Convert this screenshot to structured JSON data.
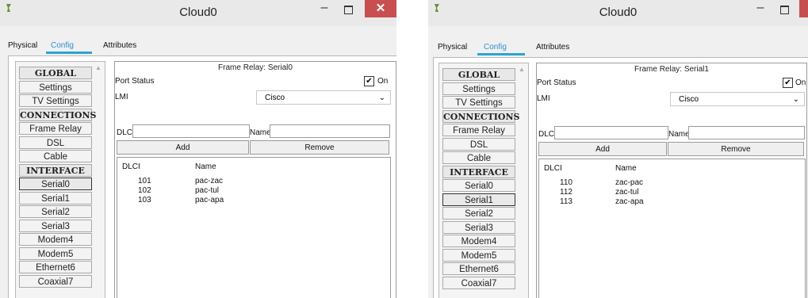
{
  "left": {
    "title": "Cloud0",
    "tabs": [
      "Physical",
      "Config",
      "Attributes"
    ],
    "sidebar": [
      {
        "label": "GLOBAL",
        "type": "header"
      },
      {
        "label": "Settings"
      },
      {
        "label": "TV Settings"
      },
      {
        "label": "CONNECTIONS",
        "type": "header"
      },
      {
        "label": "Frame Relay"
      },
      {
        "label": "DSL"
      },
      {
        "label": "Cable"
      },
      {
        "label": "INTERFACE",
        "type": "header"
      },
      {
        "label": "Serial0",
        "selected": true
      },
      {
        "label": "Serial1"
      },
      {
        "label": "Serial2"
      },
      {
        "label": "Serial3"
      },
      {
        "label": "Modem4"
      },
      {
        "label": "Modem5"
      },
      {
        "label": "Ethernet6"
      },
      {
        "label": "Coaxial7"
      }
    ],
    "frame_title": "Frame Relay: Serial0",
    "port_status_label": "Port Status",
    "on_label": "On",
    "on_checked": "✔",
    "lmi_label": "LMI",
    "lmi_value": "Cisco",
    "dlci_label": "DLCI",
    "name_label": "Name",
    "add_label": "Add",
    "remove_label": "Remove",
    "col_dlci": "DLCI",
    "col_name": "Name",
    "rows": [
      {
        "dlci": "101",
        "name": "pac-zac"
      },
      {
        "dlci": "102",
        "name": "pac-tul"
      },
      {
        "dlci": "103",
        "name": "pac-apa"
      }
    ]
  },
  "right": {
    "title": "Cloud0",
    "tabs": [
      "Physical",
      "Config",
      "Attributes"
    ],
    "sidebar": [
      {
        "label": "GLOBAL",
        "type": "header"
      },
      {
        "label": "Settings"
      },
      {
        "label": "TV Settings"
      },
      {
        "label": "CONNECTIONS",
        "type": "header"
      },
      {
        "label": "Frame Relay"
      },
      {
        "label": "DSL"
      },
      {
        "label": "Cable"
      },
      {
        "label": "INTERFACE",
        "type": "header"
      },
      {
        "label": "Serial0"
      },
      {
        "label": "Serial1",
        "selected": true
      },
      {
        "label": "Serial2"
      },
      {
        "label": "Serial3"
      },
      {
        "label": "Modem4"
      },
      {
        "label": "Modem5"
      },
      {
        "label": "Ethernet6"
      },
      {
        "label": "Coaxial7"
      }
    ],
    "frame_title": "Frame Relay: Serial1",
    "port_status_label": "Port Status",
    "on_label": "On",
    "on_checked": "✔",
    "lmi_label": "LMI",
    "lmi_value": "Cisco",
    "dlci_label": "DLCI",
    "name_label": "Name",
    "add_label": "Add",
    "remove_label": "Remove",
    "col_dlci": "DLCI",
    "col_name": "Name",
    "rows": [
      {
        "dlci": "110",
        "name": "zac-pac"
      },
      {
        "dlci": "112",
        "name": "zac-tul"
      },
      {
        "dlci": "113",
        "name": "zac-apa"
      }
    ]
  },
  "colors": {
    "close_button": "#c74f4f",
    "tab_accent": "#2aa3d6",
    "titlebar": "#e9e9e9"
  }
}
